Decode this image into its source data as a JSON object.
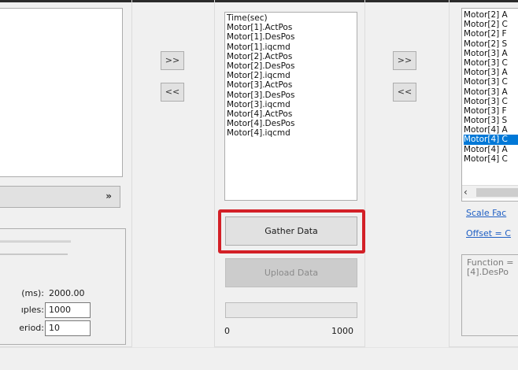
{
  "arrows": {
    "add": ">>",
    "remove": "<<"
  },
  "left": {
    "combo_icon": "double-chevron-down-icon",
    "duration_label": "(ms):",
    "duration_value": "2000.00",
    "samples_label": "ıples:",
    "samples_value": "1000",
    "period_label": "eriod:",
    "period_value": "10"
  },
  "middle": {
    "variables": [
      "Time(sec)",
      "Motor[1].ActPos",
      "Motor[1].DesPos",
      "Motor[1].iqcmd",
      "Motor[2].ActPos",
      "Motor[2].DesPos",
      "Motor[2].iqcmd",
      "Motor[3].ActPos",
      "Motor[3].DesPos",
      "Motor[3].iqcmd",
      "Motor[4].ActPos",
      "Motor[4].DesPos",
      "Motor[4].iqcmd"
    ],
    "gather_label": "Gather Data",
    "upload_label": "Upload Data",
    "progress_min": "0",
    "progress_max": "1000",
    "progress_fraction": 0
  },
  "right": {
    "items": [
      "Motor[2] A",
      "Motor[2] C",
      "Motor[2] F",
      "Motor[2] S",
      "Motor[3] A",
      "Motor[3] C",
      "Motor[3] A",
      "Motor[3] C",
      "Motor[3] A",
      "Motor[3] C",
      "Motor[3] F",
      "Motor[3] S",
      "Motor[4] A",
      "Motor[4] C",
      "Motor[4] A",
      "Motor[4] C"
    ],
    "selected_index": 13,
    "scale_link": "Scale Fac",
    "offset_link": "Offset = C",
    "function_line1": "Function =",
    "function_line2": "[4].DesPo"
  },
  "colors": {
    "highlight": "#d32027",
    "selection": "#0078d7",
    "link": "#1f5fc4"
  }
}
